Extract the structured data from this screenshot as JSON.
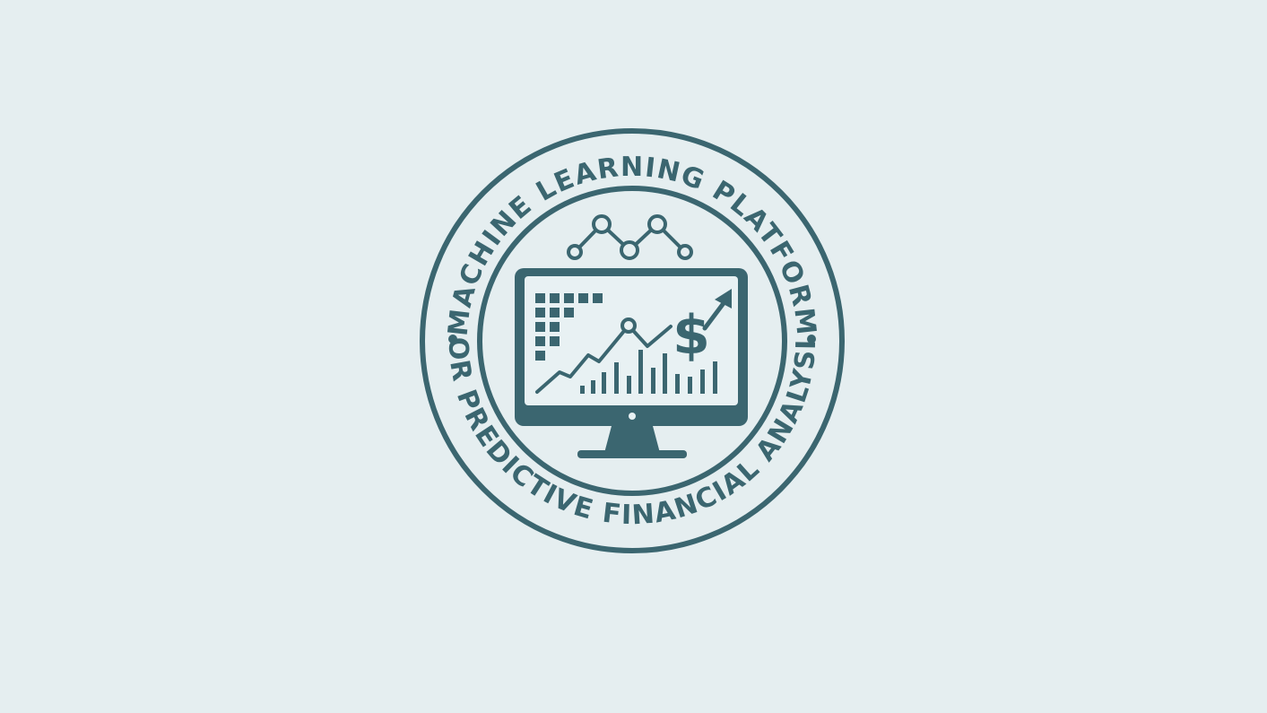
{
  "emblem": {
    "top_text": "MACHINE LEARNING PLATFORM",
    "bottom_text": "FOR PREDICTIVE FINANCIAL ANALYSIS",
    "center_icon": "computer-monitor-financial-chart-icon",
    "network_icon": "connected-nodes-icon",
    "currency_symbol": "$",
    "colors": {
      "background": "#e5eef0",
      "primary": "#3b6670",
      "screen_fill": "#e8f1f3"
    }
  }
}
